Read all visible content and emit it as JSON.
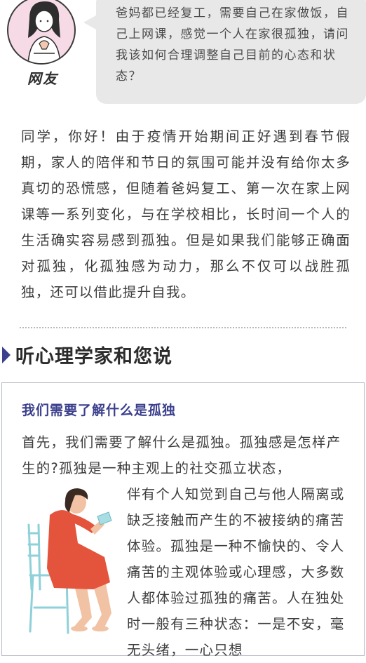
{
  "question": {
    "user_label": "网友",
    "text": "爸妈都已经复工，需要自己在家做饭，自己上网课，感觉一个人在家很孤独，请问我该如何合理调整自己目前的心态和状态？"
  },
  "answer": {
    "text": "同学，你好！由于疫情开始期间正好遇到春节假期，家人的陪伴和节日的氛围可能并没有给你太多真切的恐慌感，但随着爸妈复工、第一次在家上网课等一系列变化，与在学校相比，长时间一个人的生活确实容易感到孤独。但是如果我们能够正确面对孤独，化孤独感为动力，那么不仅可以战胜孤独，还可以借此提升自我。"
  },
  "section": {
    "title": "听心理学家和您说"
  },
  "card": {
    "title": "我们需要了解什么是孤独",
    "lead": "首先，我们需要了解什么是孤独。孤独感是怎样产生的?孤独是一种主观上的社交孤立状态，",
    "wrapped": "伴有个人知觉到自己与他人隔离或缺乏接触而产生的不被接纳的痛苦体验。孤独是一种不愉快的、令人痛苦的主观体验或心理感，大多数人都体验过孤独的痛苦。人在独处时一般有三种状态：一是不安，毫无头绪，一心只想"
  },
  "colors": {
    "accent": "#3b3f8c",
    "bubble": "#e8e8e8",
    "avatar_bg": "#f6dbe6",
    "illustration_dress": "#e4533b"
  }
}
